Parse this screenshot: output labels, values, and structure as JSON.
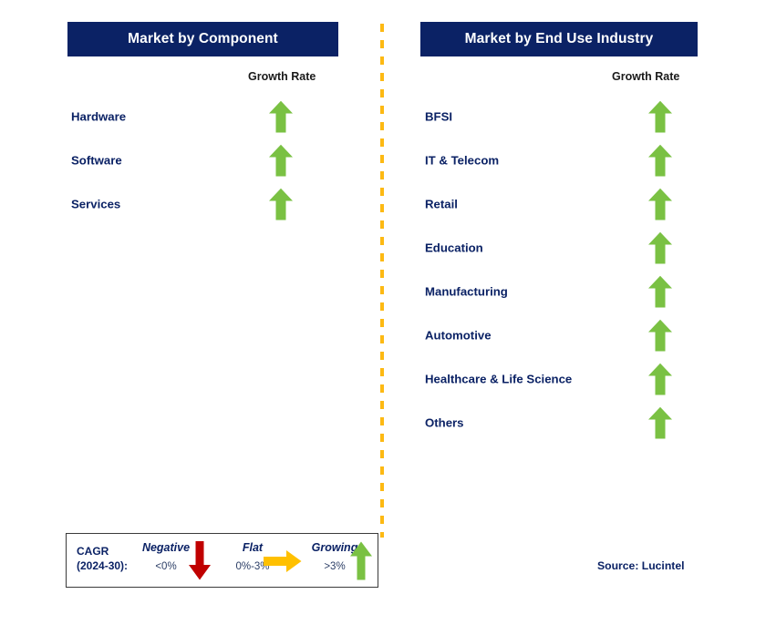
{
  "colors": {
    "header_bg": "#0b2265",
    "header_text": "#ffffff",
    "label_text": "#0b2265",
    "arrow_up": "#7AC143",
    "arrow_down": "#C00000",
    "arrow_flat": "#FFC000",
    "divider": "#FDB913",
    "legend_border": "#3a3a3a"
  },
  "panels": [
    {
      "id": "component",
      "title": "Market by Component",
      "growth_caption": "Growth Rate",
      "rows": [
        {
          "label": "Hardware",
          "growth": "Growing",
          "arrow": "arrow-up-icon"
        },
        {
          "label": "Software",
          "growth": "Growing",
          "arrow": "arrow-up-icon"
        },
        {
          "label": "Services",
          "growth": "Growing",
          "arrow": "arrow-up-icon"
        }
      ]
    },
    {
      "id": "end-use-industry",
      "title": "Market by End Use Industry",
      "growth_caption": "Growth Rate",
      "rows": [
        {
          "label": "BFSI",
          "growth": "Growing",
          "arrow": "arrow-up-icon"
        },
        {
          "label": "IT & Telecom",
          "growth": "Growing",
          "arrow": "arrow-up-icon"
        },
        {
          "label": "Retail",
          "growth": "Growing",
          "arrow": "arrow-up-icon"
        },
        {
          "label": "Education",
          "growth": "Growing",
          "arrow": "arrow-up-icon"
        },
        {
          "label": "Manufacturing",
          "growth": "Growing",
          "arrow": "arrow-up-icon"
        },
        {
          "label": "Automotive",
          "growth": "Growing",
          "arrow": "arrow-up-icon"
        },
        {
          "label": "Healthcare & Life Science",
          "growth": "Growing",
          "arrow": "arrow-up-icon"
        },
        {
          "label": "Others",
          "growth": "Growing",
          "arrow": "arrow-up-icon"
        }
      ]
    }
  ],
  "legend": {
    "title_line1": "CAGR",
    "title_line2": "(2024-30):",
    "entries": [
      {
        "word": "Negative",
        "range": "<0%",
        "arrow": "arrow-down-icon",
        "color": "#C00000"
      },
      {
        "word": "Flat",
        "range": "0%-3%",
        "arrow": "arrow-right-icon",
        "color": "#FFC000"
      },
      {
        "word": "Growing",
        "range": ">3%",
        "arrow": "arrow-up-icon",
        "color": "#7AC143"
      }
    ]
  },
  "source": "Source: Lucintel",
  "chart_data": {
    "type": "table",
    "title": "Market Growth Rate by Segment",
    "legend_scale": [
      {
        "label": "Negative",
        "range": "<0%",
        "symbol": "down arrow",
        "color": "#C00000"
      },
      {
        "label": "Flat",
        "range": "0%-3%",
        "symbol": "right arrow",
        "color": "#FFC000"
      },
      {
        "label": "Growing",
        "range": ">3%",
        "symbol": "up arrow",
        "color": "#7AC143"
      }
    ],
    "metric": "CAGR (2024-30)",
    "groups": [
      {
        "name": "Market by Component",
        "column_header": "Growth Rate",
        "categories": [
          "Hardware",
          "Software",
          "Services"
        ],
        "values": [
          "Growing",
          "Growing",
          "Growing"
        ]
      },
      {
        "name": "Market by End Use Industry",
        "column_header": "Growth Rate",
        "categories": [
          "BFSI",
          "IT & Telecom",
          "Retail",
          "Education",
          "Manufacturing",
          "Automotive",
          "Healthcare & Life Science",
          "Others"
        ],
        "values": [
          "Growing",
          "Growing",
          "Growing",
          "Growing",
          "Growing",
          "Growing",
          "Growing",
          "Growing"
        ]
      }
    ],
    "source": "Source: Lucintel"
  }
}
